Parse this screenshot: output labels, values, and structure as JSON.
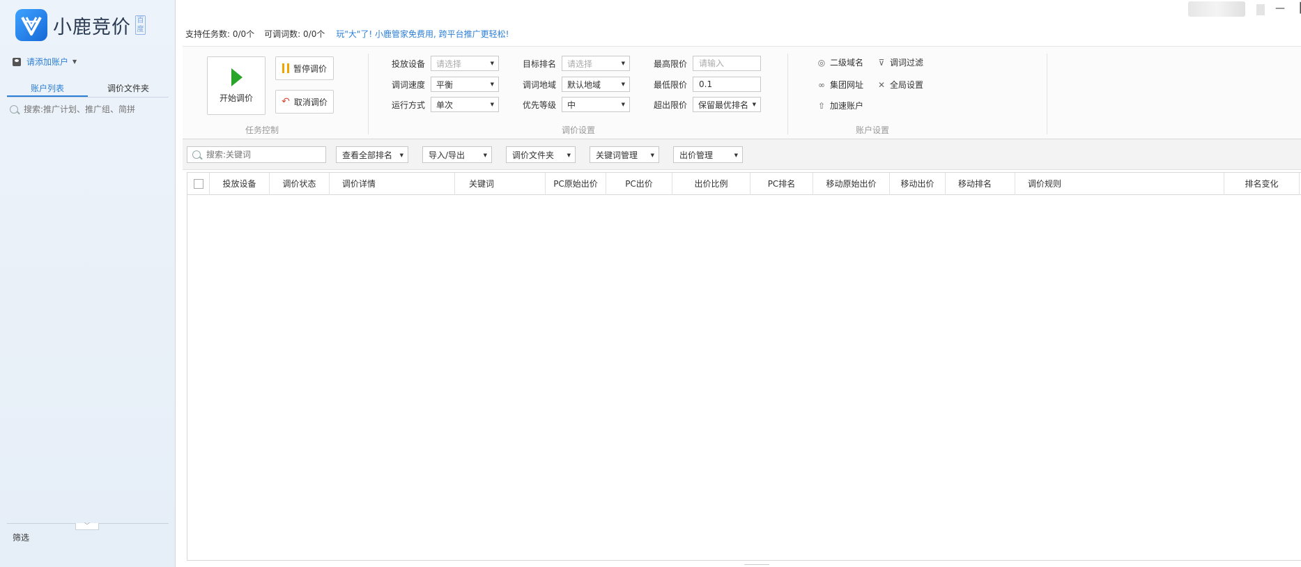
{
  "app": {
    "logo_text": "小鹿竞价",
    "logo_badge": "百度"
  },
  "sidebar": {
    "add_account": "请添加账户",
    "tabs": [
      "账户列表",
      "调价文件夹"
    ],
    "search_placeholder": "搜索:推广计划、推广组、简拼",
    "filter_label": "筛选"
  },
  "topinfo": {
    "tasks": "支持任务数: 0/0个",
    "words": "可调词数: 0/0个",
    "promo": "玩\"大\"了! 小鹿管家免费用, 跨平台推广更轻松!"
  },
  "task_control": {
    "start_label": "开始调价",
    "pause_label": "暂停调价",
    "cancel_label": "取消调价",
    "caption": "任务控制"
  },
  "price_settings": {
    "caption": "调价设置",
    "device_label": "投放设备",
    "device_value": "请选择",
    "speed_label": "调词速度",
    "speed_value": "平衡",
    "mode_label": "运行方式",
    "mode_value": "单次",
    "target_rank_label": "目标排名",
    "target_rank_value": "请选择",
    "region_label": "调词地域",
    "region_value": "默认地域",
    "priority_label": "优先等级",
    "priority_value": "中",
    "max_price_label": "最高限价",
    "max_price_placeholder": "请输入",
    "min_price_label": "最低限价",
    "min_price_value": "0.1",
    "over_limit_label": "超出限价",
    "over_limit_value": "保留最优排名"
  },
  "account_settings": {
    "caption": "账户设置",
    "subdomain": "二级域名",
    "word_filter": "调词过滤",
    "group_url": "集团网址",
    "global_settings": "全局设置",
    "accelerate": "加速账户"
  },
  "grid_toolbar": {
    "search_placeholder": "搜索:关键词",
    "view_rank": "查看全部排名",
    "import_export": "导入/导出",
    "price_folder": "调价文件夹",
    "keyword_mgmt": "关键词管理",
    "bid_mgmt": "出价管理"
  },
  "table": {
    "columns": [
      "投放设备",
      "调价状态",
      "调价详情",
      "关键词",
      "PC原始出价",
      "PC出价",
      "出价比例",
      "PC排名",
      "移动原始出价",
      "移动出价",
      "移动排名",
      "调价规则",
      "排名变化"
    ],
    "rows": []
  },
  "window": {
    "minimize": "—",
    "maximize": "▫"
  },
  "colors": {
    "accent": "#2c7fd6",
    "play": "#2aa52a",
    "pause": "#f0a400",
    "undo": "#e04b3a"
  }
}
